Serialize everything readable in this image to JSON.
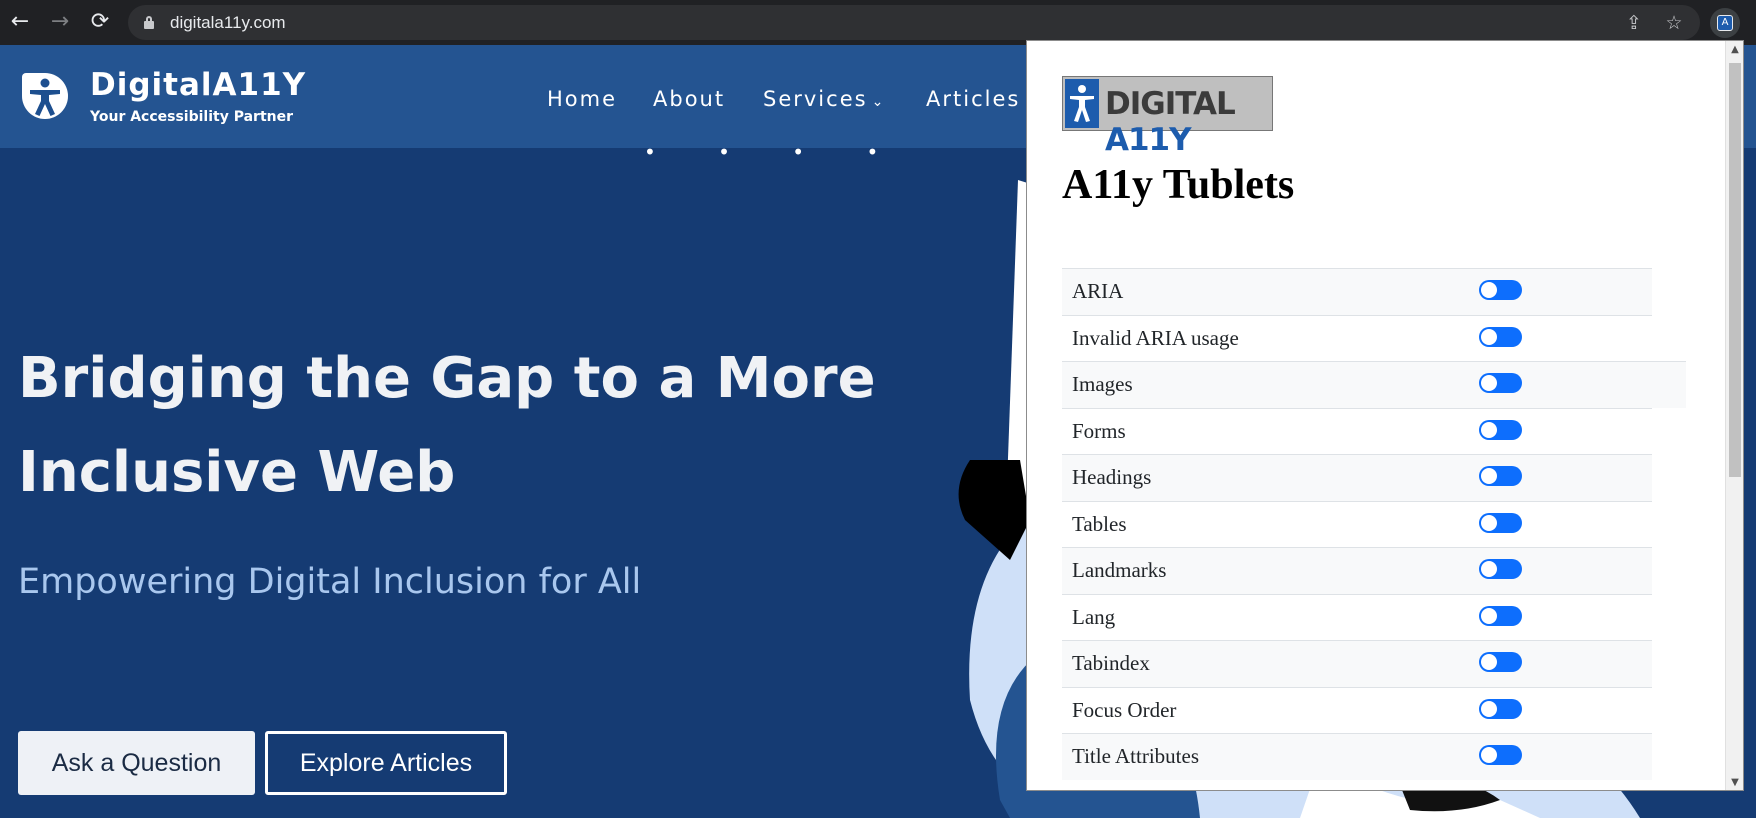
{
  "browser": {
    "back_icon": "←",
    "forward_icon": "→",
    "reload_icon": "⟳",
    "url": "digitala11y.com",
    "share_icon": "⇪",
    "star_icon": "☆",
    "extension_icon": "A"
  },
  "site": {
    "brand_name": "DigitalA11Y",
    "tagline": "Your Accessibility Partner",
    "nav": {
      "home": "Home",
      "about": "About",
      "services": "Services",
      "services_chevron": "⌄",
      "articles": "Articles"
    },
    "hero_dots": "• • • •",
    "hero_title": "Bridging the Gap to a More Inclusive Web",
    "hero_subtitle": "Empowering Digital Inclusion for All",
    "ask_button": "Ask a Question",
    "explore_button": "Explore Articles",
    "colors": {
      "header_bg": "#245491",
      "hero_bg": "#153b73"
    }
  },
  "popup": {
    "logo": {
      "text_dark": "DIGITAL",
      "text_blue": "A11Y"
    },
    "title": "A11y Tublets",
    "tablets": [
      {
        "label": "ARIA",
        "enabled": false
      },
      {
        "label": "Invalid ARIA usage",
        "enabled": false
      },
      {
        "label": "Images",
        "enabled": false
      },
      {
        "label": "Forms",
        "enabled": false
      },
      {
        "label": "Headings",
        "enabled": false
      },
      {
        "label": "Tables",
        "enabled": false
      },
      {
        "label": "Landmarks",
        "enabled": false
      },
      {
        "label": "Lang",
        "enabled": false
      },
      {
        "label": "Tabindex",
        "enabled": false
      },
      {
        "label": "Focus Order",
        "enabled": false
      },
      {
        "label": "Title Attributes",
        "enabled": false
      }
    ],
    "scroll_up_icon": "▲",
    "scroll_down_icon": "▼",
    "toggle_color": "#0d6efd"
  }
}
